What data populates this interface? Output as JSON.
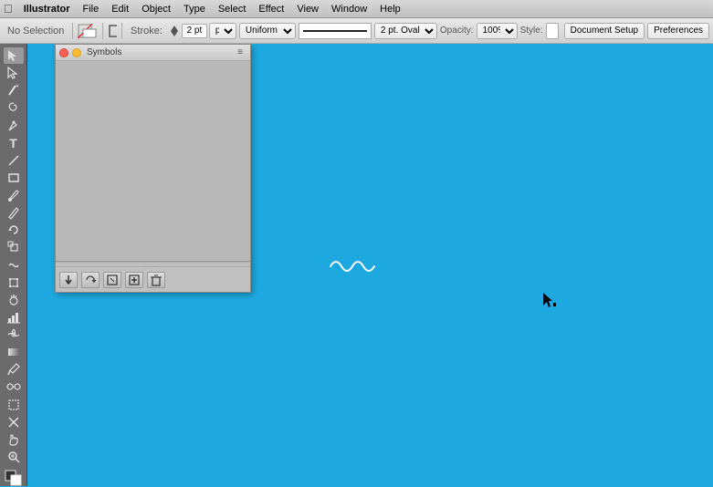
{
  "menubar": {
    "apple": "⌘",
    "items": [
      {
        "id": "illustrator",
        "label": "Illustrator"
      },
      {
        "id": "file",
        "label": "File"
      },
      {
        "id": "edit",
        "label": "Edit"
      },
      {
        "id": "object",
        "label": "Object"
      },
      {
        "id": "type",
        "label": "Type"
      },
      {
        "id": "select",
        "label": "Select"
      },
      {
        "id": "effect",
        "label": "Effect"
      },
      {
        "id": "view",
        "label": "View"
      },
      {
        "id": "window",
        "label": "Window"
      },
      {
        "id": "help",
        "label": "Help"
      }
    ]
  },
  "toolbar": {
    "no_selection_label": "No Selection",
    "stroke_label": "Stroke:",
    "stroke_value": "2 pt",
    "stroke_unit": "pt",
    "line_type": "Uniform",
    "brush_type": "2 pt. Oval",
    "opacity_label": "Opacity:",
    "opacity_value": "100%",
    "style_label": "Style:",
    "document_setup_label": "Document Setup",
    "preferences_label": "Preferences"
  },
  "symbols_panel": {
    "title": "Symbols",
    "close_btn_label": "×",
    "options_btn": "≡",
    "footer_buttons": [
      {
        "id": "place",
        "icon": "↙",
        "tooltip": "Place Symbol Instance"
      },
      {
        "id": "replace",
        "icon": "↷",
        "tooltip": "Replace Symbol"
      },
      {
        "id": "break_link",
        "icon": "⊟",
        "tooltip": "Break Link to Symbol"
      },
      {
        "id": "new",
        "icon": "⊞",
        "tooltip": "New Symbol"
      },
      {
        "id": "delete",
        "icon": "🗑",
        "tooltip": "Delete Symbol"
      }
    ]
  },
  "tools": [
    {
      "id": "selection",
      "icon": "↖",
      "label": "Selection Tool"
    },
    {
      "id": "direct-selection",
      "icon": "↗",
      "label": "Direct Selection Tool"
    },
    {
      "id": "magic-wand",
      "icon": "✦",
      "label": "Magic Wand Tool"
    },
    {
      "id": "lasso",
      "icon": "◌",
      "label": "Lasso Tool"
    },
    {
      "id": "pen",
      "icon": "✒",
      "label": "Pen Tool"
    },
    {
      "id": "type",
      "icon": "T",
      "label": "Type Tool"
    },
    {
      "id": "line",
      "icon": "╱",
      "label": "Line Segment Tool"
    },
    {
      "id": "rectangle",
      "icon": "□",
      "label": "Rectangle Tool"
    },
    {
      "id": "paintbrush",
      "icon": "🖌",
      "label": "Paintbrush Tool"
    },
    {
      "id": "pencil",
      "icon": "✏",
      "label": "Pencil Tool"
    },
    {
      "id": "rotate",
      "icon": "↻",
      "label": "Rotate Tool"
    },
    {
      "id": "scale",
      "icon": "⤢",
      "label": "Scale Tool"
    },
    {
      "id": "warp",
      "icon": "≋",
      "label": "Warp Tool"
    },
    {
      "id": "free-transform",
      "icon": "⊹",
      "label": "Free Transform Tool"
    },
    {
      "id": "symbol-sprayer",
      "icon": "⊛",
      "label": "Symbol Sprayer Tool"
    },
    {
      "id": "column-graph",
      "icon": "📊",
      "label": "Column Graph Tool"
    },
    {
      "id": "mesh",
      "icon": "⊞",
      "label": "Mesh Tool"
    },
    {
      "id": "gradient",
      "icon": "▨",
      "label": "Gradient Tool"
    },
    {
      "id": "eyedropper",
      "icon": "⊙",
      "label": "Eyedropper Tool"
    },
    {
      "id": "blend",
      "icon": "⊗",
      "label": "Blend Tool"
    },
    {
      "id": "artboard",
      "icon": "⊡",
      "label": "Artboard Tool"
    },
    {
      "id": "slice",
      "icon": "⊘",
      "label": "Slice Tool"
    },
    {
      "id": "hand",
      "icon": "✋",
      "label": "Hand Tool"
    },
    {
      "id": "zoom",
      "icon": "⊕",
      "label": "Zoom Tool"
    },
    {
      "id": "fill-stroke",
      "icon": "◼",
      "label": "Fill and Stroke"
    }
  ],
  "canvas": {
    "background_color": "#1da8e0"
  }
}
